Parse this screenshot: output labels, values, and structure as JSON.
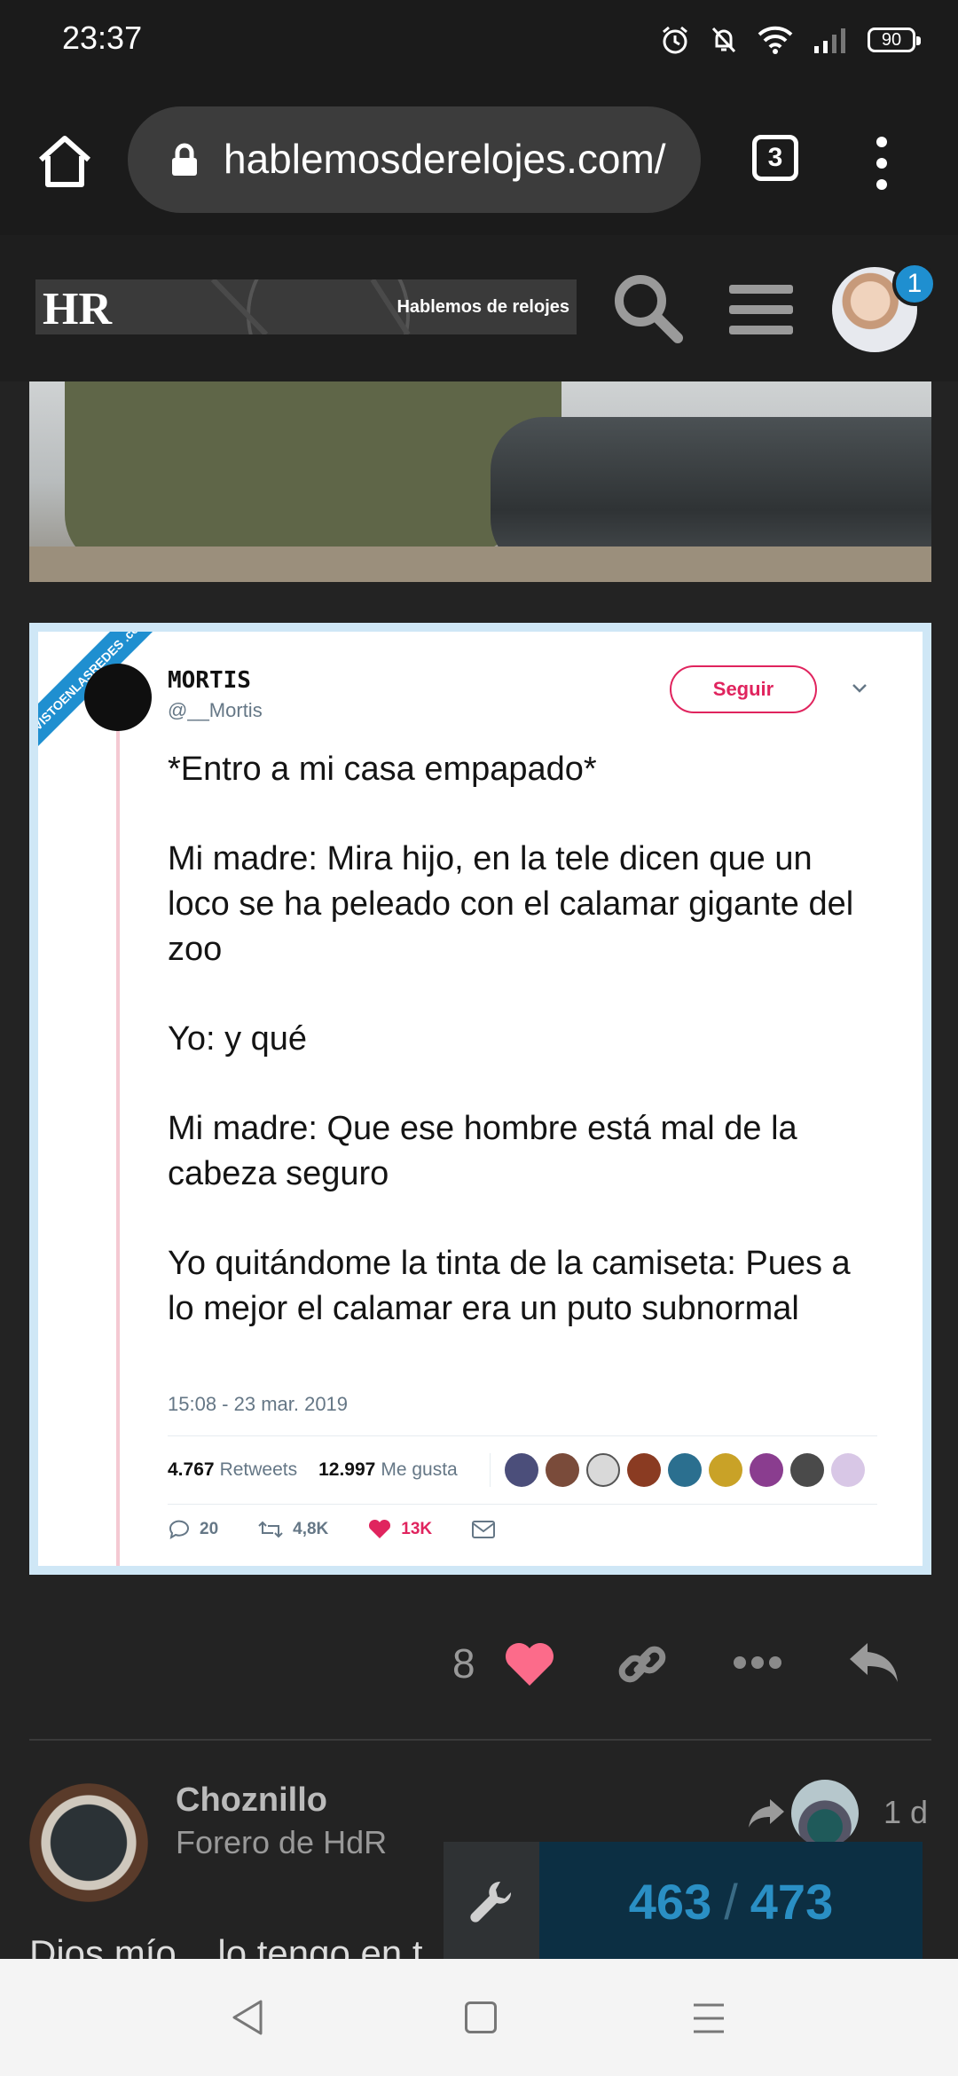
{
  "status_bar": {
    "time": "23:37",
    "battery": "90"
  },
  "browser": {
    "url": "hablemosderelojes.com/",
    "tab_count": "3"
  },
  "site_header": {
    "logo_text": "HR",
    "logo_subtitle": "Hablemos de relojes",
    "notification_count": "1"
  },
  "tweet": {
    "ribbon": "VISTOENLASREDES .com",
    "author_name": "MORTIS",
    "author_handle": "@__Mortis",
    "follow_label": "Seguir",
    "text_paragraphs": [
      "*Entro a mi casa empapado*",
      "Mi madre: Mira hijo, en la tele dicen que un loco se ha peleado con el calamar gigante del zoo",
      "Yo: y qué",
      "Mi madre: Que ese hombre está mal de la cabeza seguro",
      "Yo quitándome la tinta de la camiseta: Pues a lo mejor el calamar era un puto subnormal"
    ],
    "date": "15:08 - 23 mar. 2019",
    "retweets_count": "4.767",
    "retweets_label": "Retweets",
    "likes_count": "12.997",
    "likes_label": "Me gusta",
    "replies": "20",
    "retweets_short": "4,8K",
    "likes_short": "13K"
  },
  "post_actions": {
    "like_count": "8"
  },
  "reply": {
    "author": "Choznillo",
    "user_title": "Forero de HdR",
    "age": "1 d",
    "text_preview": "Dios mío... lo tengo en t"
  },
  "progress": {
    "current": "463",
    "separator": "/",
    "total": "473"
  },
  "colors": {
    "accent": "#1f8fd0",
    "heart": "#e0245e",
    "background": "#232323"
  }
}
